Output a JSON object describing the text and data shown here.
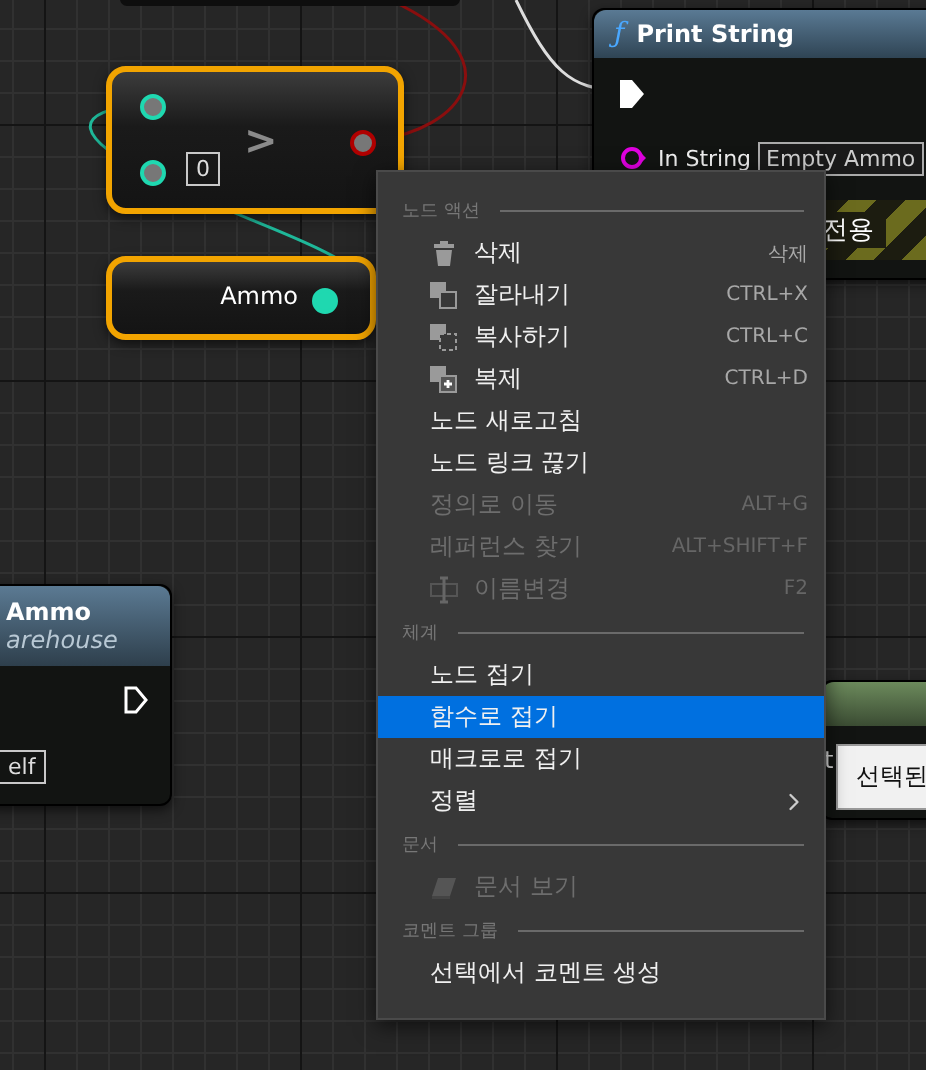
{
  "canvas": {
    "compare_node": {
      "operator": ">",
      "default_value": "0"
    },
    "variable_node": {
      "label": "Ammo"
    },
    "print_node": {
      "icon_glyph": "ƒ",
      "title": "Print String",
      "pin_label": "In String",
      "pin_value": "Empty Ammo",
      "note": "전용"
    },
    "left_node": {
      "title": "Ammo",
      "subtitle": "arehouse",
      "field_value": "elf"
    },
    "right_node": {
      "label": "t"
    },
    "tooltip": "선택된"
  },
  "context_menu": {
    "sections": [
      {
        "header": "노드 액션",
        "items": [
          {
            "label": "삭제",
            "kind": "delete",
            "shortcut": "삭제",
            "disabled": false,
            "selected": false,
            "submenu": false
          },
          {
            "label": "잘라내기",
            "kind": "cut",
            "shortcut": "CTRL+X",
            "disabled": false,
            "selected": false,
            "submenu": false
          },
          {
            "label": "복사하기",
            "kind": "copy",
            "shortcut": "CTRL+C",
            "disabled": false,
            "selected": false,
            "submenu": false
          },
          {
            "label": "복제",
            "kind": "duplicate",
            "shortcut": "CTRL+D",
            "disabled": false,
            "selected": false,
            "submenu": false
          },
          {
            "label": "노드 새로고침",
            "kind": "plain",
            "disabled": false,
            "selected": false,
            "submenu": false
          },
          {
            "label": "노드 링크 끊기",
            "kind": "plain",
            "disabled": false,
            "selected": false,
            "submenu": false
          },
          {
            "label": "정의로 이동",
            "kind": "plain",
            "shortcut": "ALT+G",
            "disabled": true,
            "selected": false,
            "submenu": false
          },
          {
            "label": "레퍼런스 찾기",
            "kind": "plain",
            "shortcut": "ALT+SHIFT+F",
            "disabled": true,
            "selected": false,
            "submenu": false
          },
          {
            "label": "이름변경",
            "kind": "rename",
            "shortcut": "F2",
            "disabled": true,
            "selected": false,
            "submenu": false
          }
        ]
      },
      {
        "header": "체계",
        "items": [
          {
            "label": "노드 접기",
            "kind": "plain",
            "disabled": false,
            "selected": false,
            "submenu": false
          },
          {
            "label": "함수로 접기",
            "kind": "plain",
            "disabled": false,
            "selected": true,
            "submenu": false
          },
          {
            "label": "매크로로 접기",
            "kind": "plain",
            "disabled": false,
            "selected": false,
            "submenu": false
          },
          {
            "label": "정렬",
            "kind": "plain",
            "disabled": false,
            "selected": false,
            "submenu": true
          }
        ]
      },
      {
        "header": "문서",
        "items": [
          {
            "label": "문서 보기",
            "kind": "docs",
            "disabled": true,
            "selected": false,
            "submenu": false
          }
        ]
      },
      {
        "header": "코멘트 그룹",
        "items": [
          {
            "label": "선택에서 코멘트 생성",
            "kind": "plain",
            "disabled": false,
            "selected": false,
            "submenu": false
          }
        ]
      }
    ]
  }
}
